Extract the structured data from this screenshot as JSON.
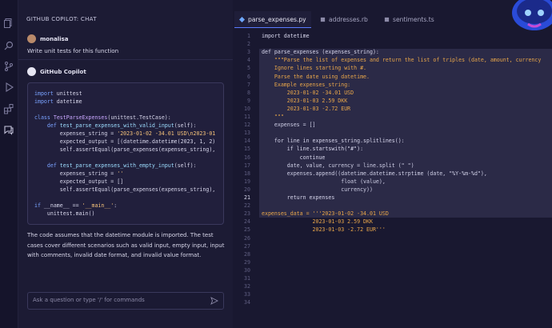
{
  "chat": {
    "title": "GITHUB COPILOT: CHAT",
    "user": {
      "name": "monalisa",
      "message": "Write unit tests for this function"
    },
    "assistant": {
      "name": "GitHub Copilot"
    },
    "code_lines": [
      "import unittest",
      "import datetime",
      "",
      "class TestParseExpenses(unittest.TestCase):",
      "    def test_parse_expenses_with_valid_input(self):",
      "        expenses_string = '2023-01-02 -34.01 USD\\n2023-01",
      "        expected_output = [(datetime.datetime(2023, 1, 2)",
      "        self.assertEqual(parse_expenses(expenses_string),",
      "",
      "    def test_parse_expenses_with_empty_input(self):",
      "        expenses_string = ''",
      "        expected_output = []",
      "        self.assertEqual(parse_expenses(expenses_string),",
      "",
      "if __name__ == '__main__':",
      "    unittest.main()"
    ],
    "answer": "The code assumes that the datetime module is imported. The test cases cover different scenarios such as valid input, empty input, input with comments, invalid date format, and invalid value format.",
    "input_placeholder": "Ask a question or type '/' for commands"
  },
  "editor": {
    "tabs": [
      {
        "label": "parse_expenses.py",
        "icon": "python-file-icon",
        "active": true
      },
      {
        "label": "addresses.rb",
        "icon": "ruby-file-icon",
        "active": false
      },
      {
        "label": "sentiments.ts",
        "icon": "typescript-file-icon",
        "active": false
      }
    ],
    "current_line": "21",
    "line_numbers": [
      "1",
      "2",
      "3",
      "4",
      "5",
      "6",
      "7",
      "8",
      "9",
      "10",
      "11",
      "12",
      "13",
      "14",
      "15",
      "16",
      "17",
      "18",
      "19",
      "20",
      "21",
      "22",
      "23",
      "24",
      "25",
      "26",
      "27",
      "28",
      "29",
      "30",
      "31",
      "32",
      "33",
      "34"
    ],
    "lines": [
      "import datetime",
      "",
      "def parse_expenses (expenses_string):",
      "    \"\"\"Parse the list of expenses and return the list of triples (date, amount, currency",
      "    Ignore lines starting with #.",
      "    Parse the date using datetime.",
      "    Example expenses_string:",
      "        2023-01-02 -34.01 USD",
      "        2023-01-03 2.59 DKK",
      "        2023-01-03 -2.72 EUR",
      "    \"\"\"",
      "    expenses = []",
      "",
      "    for line in expenses_string.splitlines():",
      "        if line.startswith(\"#\"):",
      "            continue",
      "        date, value, currency = line.split (\" \")",
      "        expenses.append((datetime.datetime.strptime (date, \"%Y-%m-%d\"),",
      "                         float (value),",
      "                         currency))",
      "        return expenses",
      "",
      "expenses_data = '''2023-01-02 -34.01 USD",
      "                2023-01-03 2.59 DKK",
      "                2023-01-03 -2.72 EUR'''",
      "",
      "",
      "",
      "",
      "",
      "",
      "",
      "",
      ""
    ]
  },
  "colors": {
    "accent": "#5a7bff",
    "background": "#161530",
    "selection": "#2b2a47"
  }
}
